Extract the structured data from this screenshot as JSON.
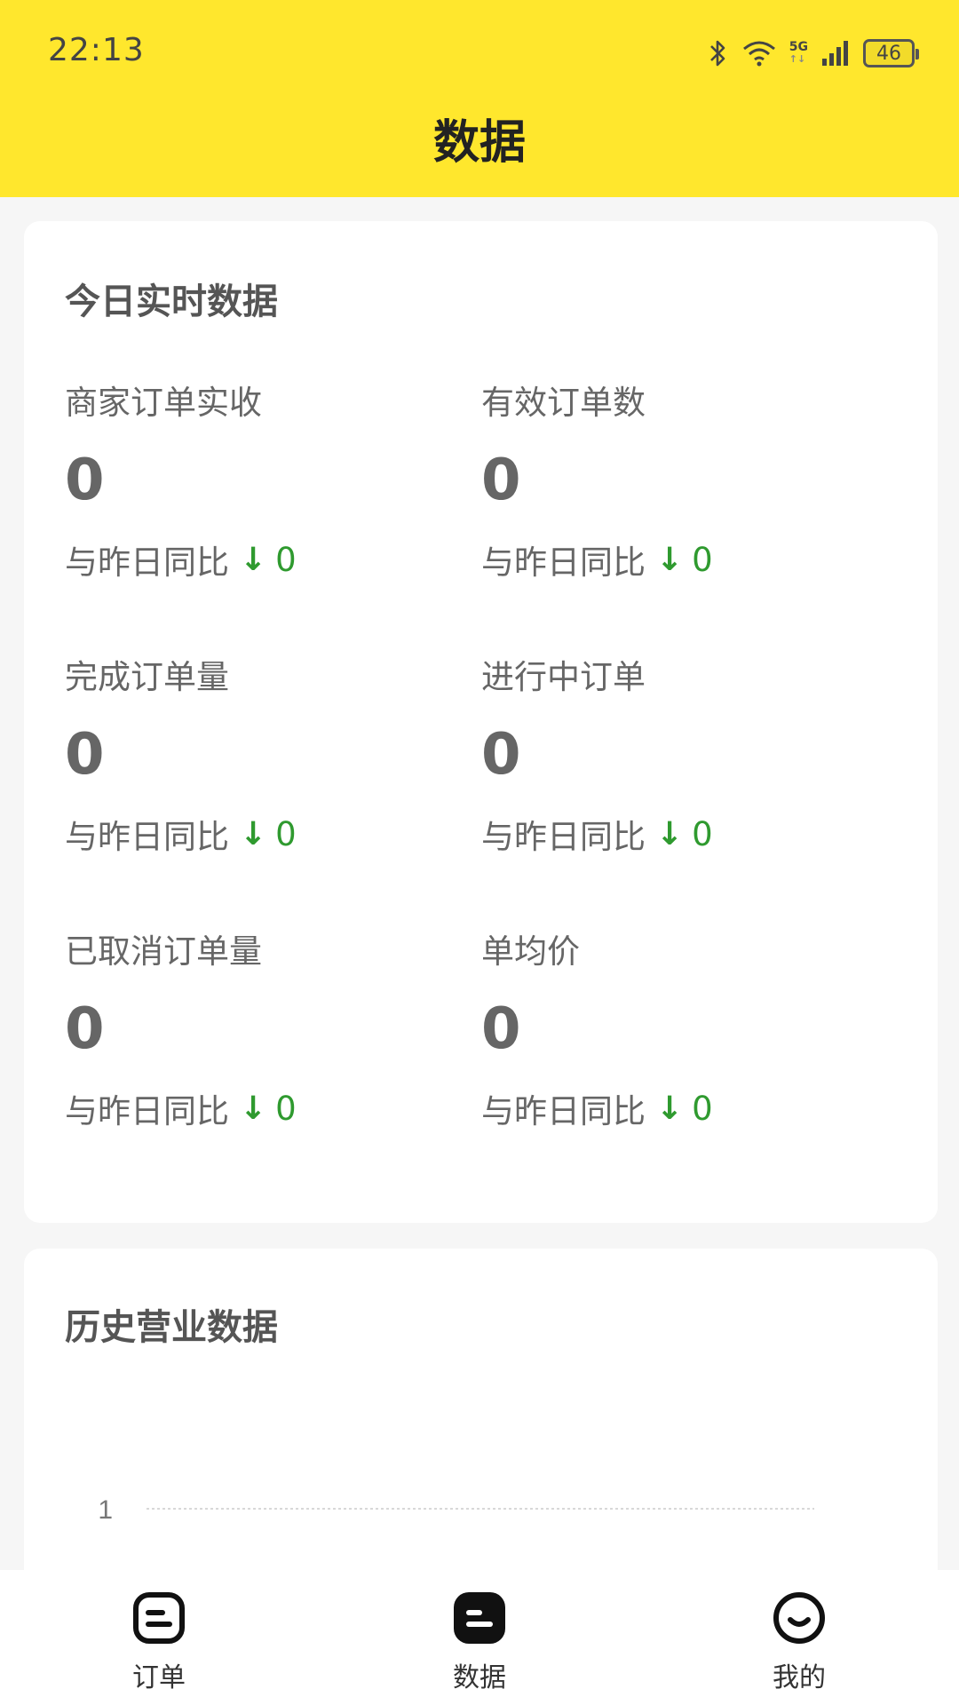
{
  "status_bar": {
    "time": "22:13",
    "network": "5G",
    "battery": "46"
  },
  "header": {
    "title": "数据"
  },
  "today": {
    "title": "今日实时数据",
    "compare_label": "与昨日同比",
    "metrics": [
      {
        "label": "商家订单实收",
        "value": "0",
        "delta": "0"
      },
      {
        "label": "有效订单数",
        "value": "0",
        "delta": "0"
      },
      {
        "label": "完成订单量",
        "value": "0",
        "delta": "0"
      },
      {
        "label": "进行中订单",
        "value": "0",
        "delta": "0"
      },
      {
        "label": "已取消订单量",
        "value": "0",
        "delta": "0"
      },
      {
        "label": "单均价",
        "value": "0",
        "delta": "0"
      }
    ]
  },
  "history": {
    "title": "历史营业数据",
    "chart_data": {
      "type": "line",
      "title": "",
      "xlabel": "",
      "ylabel": "",
      "y_ticks": [
        "1"
      ],
      "grid": true
    }
  },
  "tabbar": {
    "items": [
      {
        "label": "订单",
        "icon": "order-icon",
        "active": false
      },
      {
        "label": "数据",
        "icon": "data-icon",
        "active": true
      },
      {
        "label": "我的",
        "icon": "profile-icon",
        "active": false
      }
    ]
  },
  "colors": {
    "brand_yellow": "#ffe72d",
    "down_green": "#2f9a2f"
  }
}
